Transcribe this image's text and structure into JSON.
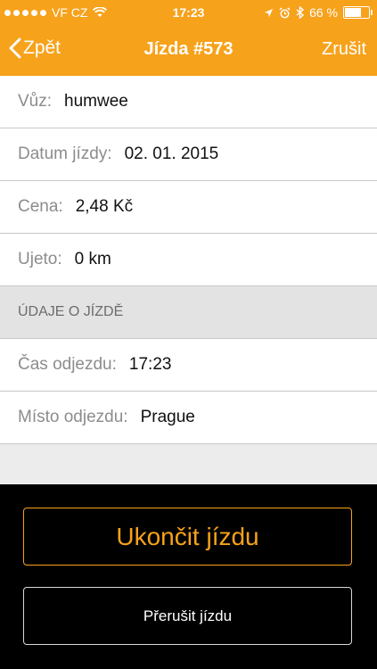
{
  "status_bar": {
    "carrier": "VF CZ",
    "time": "17:23",
    "battery": "66 %",
    "battery_level": 0.66
  },
  "nav": {
    "back_label": "Zpět",
    "title": "Jízda #573",
    "action_label": "Zrušit"
  },
  "rows": [
    {
      "label": "Vůz:",
      "value": "humwee"
    },
    {
      "label": "Datum jízdy:",
      "value": "02. 01. 2015"
    },
    {
      "label": "Cena:",
      "value": "2,48 Kč"
    },
    {
      "label": "Ujeto:",
      "value": "0 km"
    }
  ],
  "section_header": "ÚDAJE O JÍZDĚ",
  "details": [
    {
      "label": "Čas odjezdu:",
      "value": "17:23"
    },
    {
      "label": "Místo odjezdu:",
      "value": "Prague"
    }
  ],
  "buttons": {
    "end_label": "Ukončit jízdu",
    "pause_label": "Přerušit jízdu"
  },
  "colors": {
    "accent": "#f7a21b",
    "bottom_bg": "#000000"
  }
}
